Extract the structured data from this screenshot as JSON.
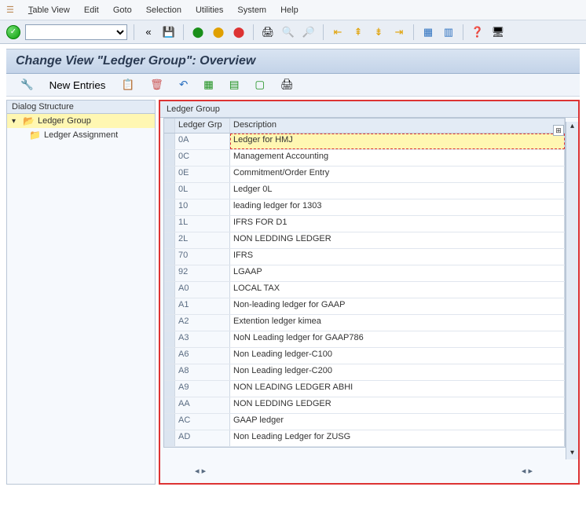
{
  "menu": {
    "table_view": "Table View",
    "edit": "Edit",
    "goto": "Goto",
    "selection": "Selection",
    "utilities": "Utilities",
    "system": "System",
    "help": "Help"
  },
  "title": "Change View \"Ledger Group\": Overview",
  "actions": {
    "new_entries": "New Entries"
  },
  "tree": {
    "head": "Dialog Structure",
    "root": "Ledger Group",
    "child": "Ledger Assignment"
  },
  "panel": {
    "head": "Ledger Group",
    "col1": "Ledger Grp",
    "col2": "Description"
  },
  "rows": [
    {
      "grp": "0A",
      "desc": "Ledger for HMJ"
    },
    {
      "grp": "0C",
      "desc": "Management Accounting"
    },
    {
      "grp": "0E",
      "desc": "Commitment/Order Entry"
    },
    {
      "grp": "0L",
      "desc": "Ledger 0L"
    },
    {
      "grp": "10",
      "desc": "leading ledger for 1303"
    },
    {
      "grp": "1L",
      "desc": "IFRS FOR D1"
    },
    {
      "grp": "2L",
      "desc": "NON LEDDING LEDGER"
    },
    {
      "grp": "70",
      "desc": "IFRS"
    },
    {
      "grp": "92",
      "desc": "LGAAP"
    },
    {
      "grp": "A0",
      "desc": "LOCAL TAX"
    },
    {
      "grp": "A1",
      "desc": "Non-leading ledger for GAAP"
    },
    {
      "grp": "A2",
      "desc": "Extention ledger kimea"
    },
    {
      "grp": "A3",
      "desc": "NoN Leading ledger for GAAP786"
    },
    {
      "grp": "A6",
      "desc": "Non Leading ledger-C100"
    },
    {
      "grp": "A8",
      "desc": "Non Leading ledger-C200"
    },
    {
      "grp": "A9",
      "desc": "NON LEADING LEDGER ABHI"
    },
    {
      "grp": "AA",
      "desc": "NON LEDDING LEDGER"
    },
    {
      "grp": "AC",
      "desc": "GAAP ledger"
    },
    {
      "grp": "AD",
      "desc": "Non Leading Ledger for ZUSG"
    }
  ]
}
